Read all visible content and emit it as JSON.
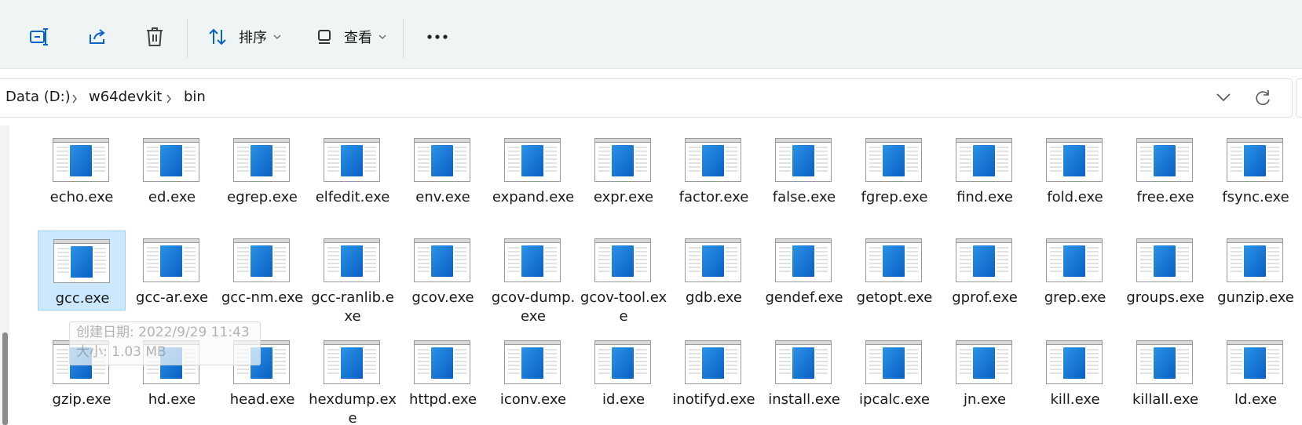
{
  "colors": {
    "toolbar_bg": "#eef5f4",
    "accent": "#0a63c9",
    "selection_bg": "#cce8ff",
    "selection_border": "#99d1ff"
  },
  "toolbar": {
    "rename_icon": "rename-icon",
    "share_icon": "share-icon",
    "delete_icon": "trash-icon",
    "sort_label": "排序",
    "view_label": "查看",
    "more_label": "···"
  },
  "address": {
    "crumbs": [
      "Data (D:)",
      "w64devkit",
      "bin"
    ]
  },
  "files": [
    [
      "echo.exe",
      "ed.exe",
      "egrep.exe",
      "elfedit.exe",
      "env.exe",
      "expand.exe",
      "expr.exe",
      "factor.exe",
      "false.exe",
      "fgrep.exe",
      "find.exe",
      "fold.exe",
      "free.exe",
      "fsync.exe"
    ],
    [
      "gcc.exe",
      "gcc-ar.exe",
      "gcc-nm.exe",
      "gcc-ranlib.exe",
      "gcov.exe",
      "gcov-dump.exe",
      "gcov-tool.exe",
      "gdb.exe",
      "gendef.exe",
      "getopt.exe",
      "gprof.exe",
      "grep.exe",
      "groups.exe",
      "gunzip.exe"
    ],
    [
      "gzip.exe",
      "hd.exe",
      "head.exe",
      "hexdump.exe",
      "httpd.exe",
      "iconv.exe",
      "id.exe",
      "inotifyd.exe",
      "install.exe",
      "ipcalc.exe",
      "jn.exe",
      "kill.exe",
      "killall.exe",
      "ld.exe"
    ]
  ],
  "selected_file": "gcc.exe",
  "tooltip": {
    "created": "创建日期: 2022/9/29 11:43",
    "size": "大小: 1.03 MB"
  }
}
